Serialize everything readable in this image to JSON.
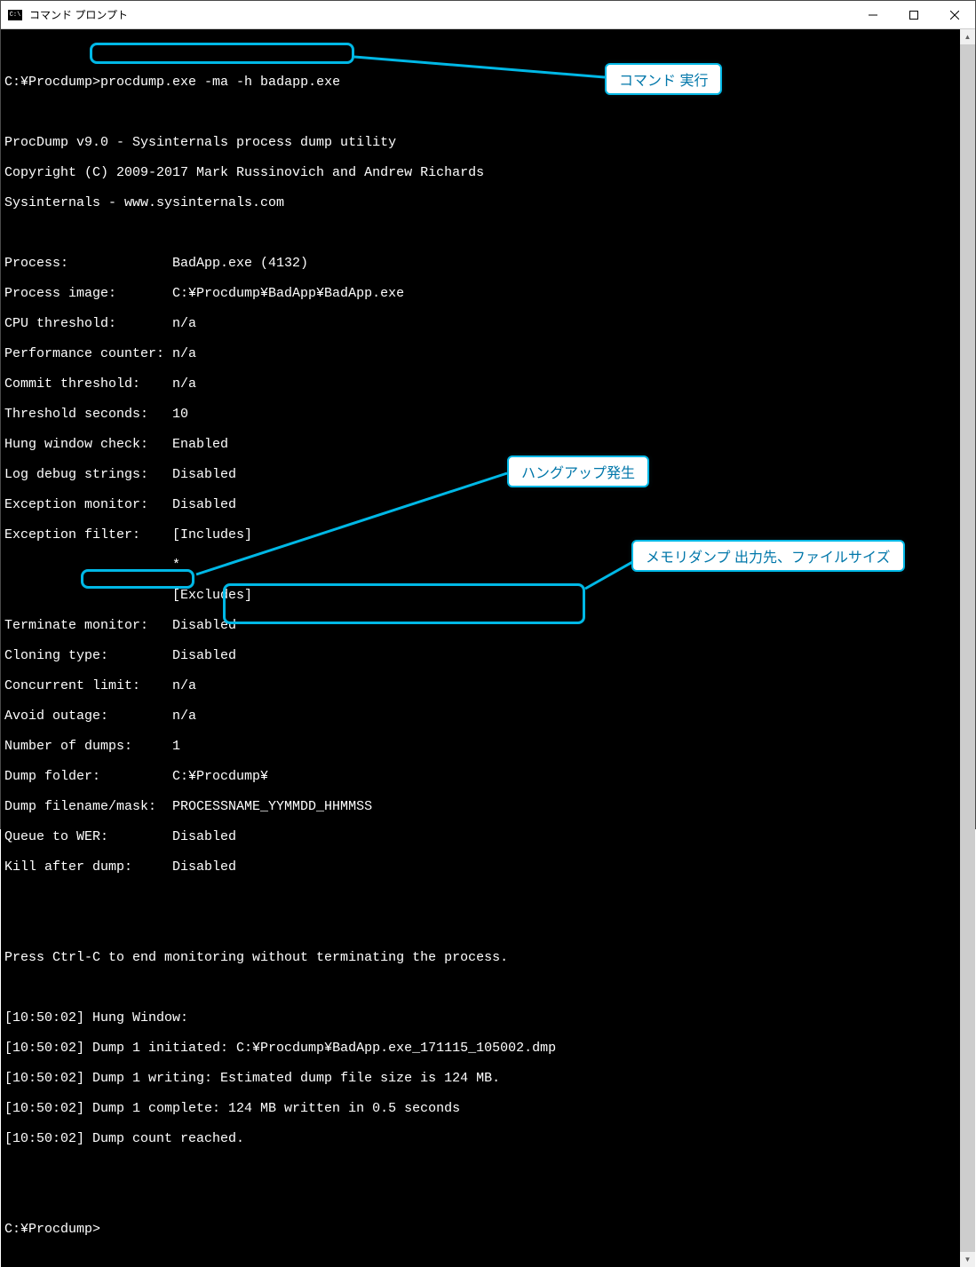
{
  "window": {
    "title": "コマンド プロンプト"
  },
  "prompt_path": "C:¥Procdump>",
  "command": "procdump.exe -ma -h badapp.exe",
  "banner": {
    "l1": "ProcDump v9.0 - Sysinternals process dump utility",
    "l2": "Copyright (C) 2009-2017 Mark Russinovich and Andrew Richards",
    "l3": "Sysinternals - www.sysinternals.com"
  },
  "info": {
    "process": "Process:             BadApp.exe (4132)",
    "image": "Process image:       C:¥Procdump¥BadApp¥BadApp.exe",
    "cpu": "CPU threshold:       n/a",
    "perf": "Performance counter: n/a",
    "commit": "Commit threshold:    n/a",
    "threshsec": "Threshold seconds:   10",
    "hung": "Hung window check:   Enabled",
    "logdbg": "Log debug strings:   Disabled",
    "excmon": "Exception monitor:   Disabled",
    "excfilt": "Exception filter:    [Includes]",
    "excfilt_star": "                     *",
    "excfilt_excl": "                     [Excludes]",
    "termmon": "Terminate monitor:   Disabled",
    "clone": "Cloning type:        Disabled",
    "conclimit": "Concurrent limit:    n/a",
    "avoid": "Avoid outage:        n/a",
    "numdumps": "Number of dumps:     1",
    "folder": "Dump folder:         C:¥Procdump¥",
    "mask": "Dump filename/mask:  PROCESSNAME_YYMMDD_HHMMSS",
    "wer": "Queue to WER:        Disabled",
    "kill": "Kill after dump:     Disabled"
  },
  "hint": "Press Ctrl-C to end monitoring without terminating the process.",
  "log_ts": "[10:50:02]",
  "log": {
    "hung_label": " Hung Window:",
    "init_pre": " Dump 1 initiated: ",
    "init_path": "C:¥Procdump¥BadApp.exe_171115_105002.dmp",
    "writing": " Dump 1 writing: Estimated dump file size is 124 MB.",
    "complete": " Dump 1 complete: 124 MB written in 0.5 seconds",
    "count": " Dump count reached."
  },
  "final_prompt": "C:¥Procdump>",
  "callouts": {
    "cmd": "コマンド 実行",
    "hang": "ハングアップ発生",
    "dump": "メモリダンプ 出力先、ファイルサイズ"
  },
  "colors": {
    "annotation": "#00b8e6",
    "callout_text": "#0077aa"
  }
}
